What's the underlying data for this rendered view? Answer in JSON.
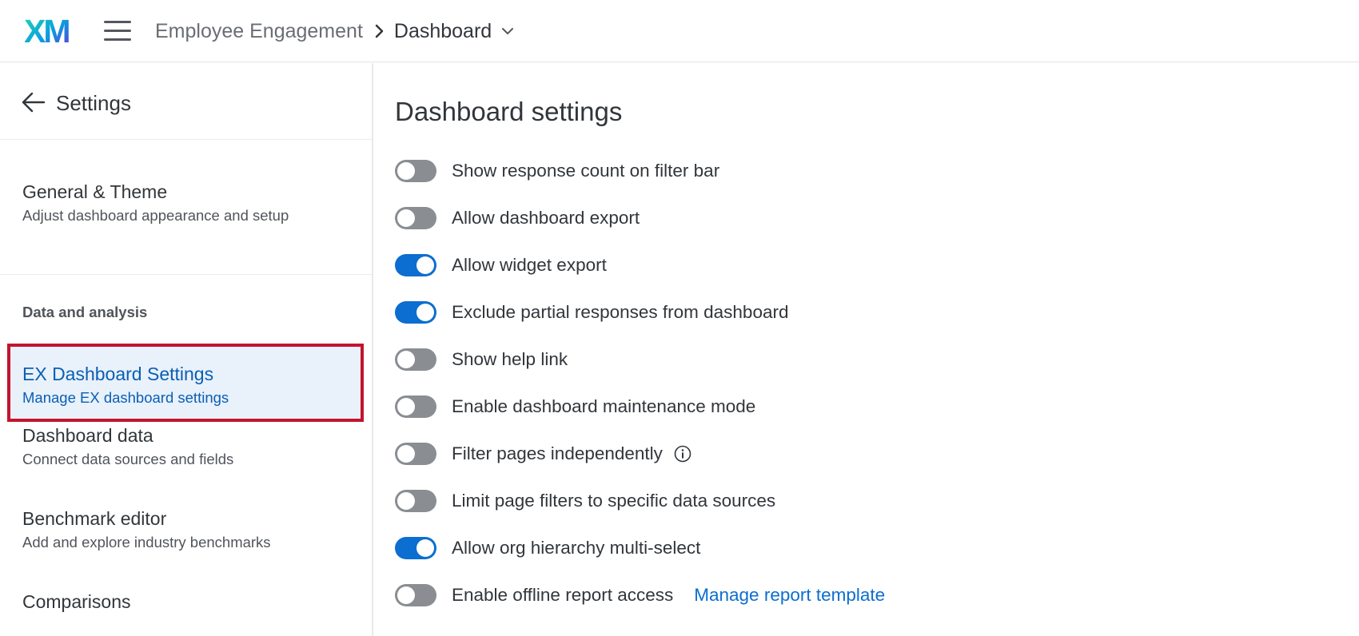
{
  "header": {
    "logo_text": "XM",
    "breadcrumb": {
      "project": "Employee Engagement",
      "current": "Dashboard"
    }
  },
  "sidebar": {
    "title": "Settings",
    "items": [
      {
        "title": "General & Theme",
        "subtitle": "Adjust dashboard appearance and setup"
      }
    ],
    "section_label": "Data and analysis",
    "section_items": [
      {
        "title": "EX Dashboard Settings",
        "subtitle": "Manage EX dashboard settings",
        "active": true
      },
      {
        "title": "Dashboard data",
        "subtitle": "Connect data sources and fields"
      },
      {
        "title": "Benchmark editor",
        "subtitle": "Add and explore industry benchmarks"
      },
      {
        "title": "Comparisons",
        "subtitle": ""
      }
    ]
  },
  "main": {
    "title": "Dashboard settings",
    "settings": [
      {
        "label": "Show response count on filter bar",
        "enabled": false
      },
      {
        "label": "Allow dashboard export",
        "enabled": false
      },
      {
        "label": "Allow widget export",
        "enabled": true
      },
      {
        "label": "Exclude partial responses from dashboard",
        "enabled": true
      },
      {
        "label": "Show help link",
        "enabled": false
      },
      {
        "label": "Enable dashboard maintenance mode",
        "enabled": false
      },
      {
        "label": "Filter pages independently",
        "enabled": false,
        "info_icon": "info-icon"
      },
      {
        "label": "Limit page filters to specific data sources",
        "enabled": false
      },
      {
        "label": "Allow org hierarchy multi-select",
        "enabled": true
      },
      {
        "label": "Enable offline report access",
        "enabled": false,
        "link": "Manage report template"
      }
    ]
  },
  "colors": {
    "accent": "#0b6ed0",
    "toggle_off": "#8a8d91",
    "active_highlight_border": "#c4142e",
    "active_bg": "#e9f1fb",
    "link": "#0b6ed0"
  }
}
